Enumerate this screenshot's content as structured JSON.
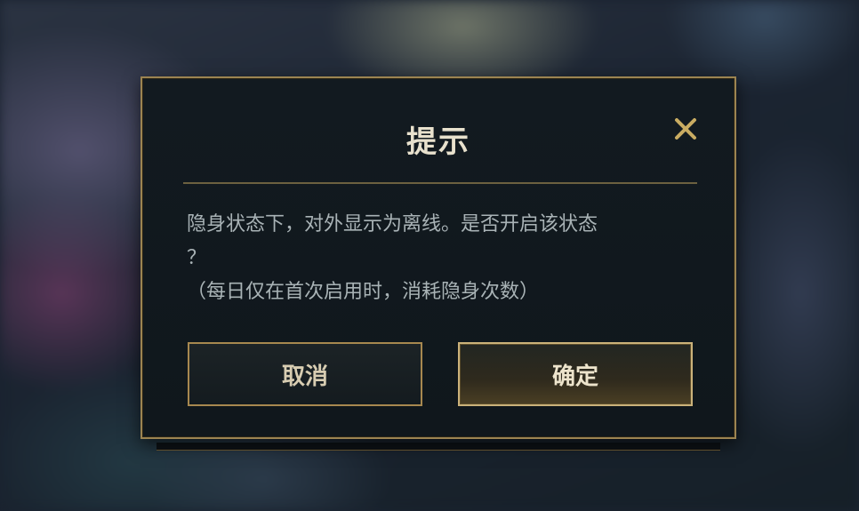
{
  "dialog": {
    "title": "提示",
    "message_line1": "隐身状态下，对外显示为离线。是否开启该状态",
    "message_line2": "？",
    "message_line3": "（每日仅在首次启用时，消耗隐身次数）",
    "cancel_label": "取消",
    "confirm_label": "确定",
    "close_icon": "close-icon"
  },
  "colors": {
    "border_gold": "#9c8451",
    "title_text": "#e8e1cd",
    "body_text": "#a9b3b6",
    "close_icon_gold": "#c9ac62",
    "panel_bg": "#121a20"
  }
}
